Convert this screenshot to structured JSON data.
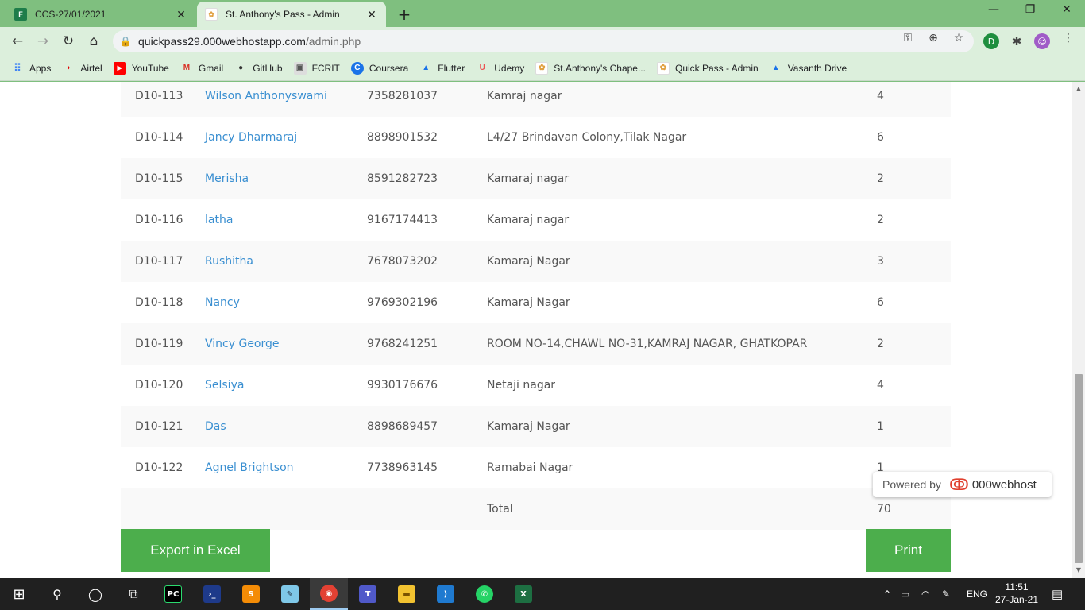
{
  "browser": {
    "tabs": [
      {
        "title": "CCS-27/01/2021",
        "icon": "forms-icon"
      },
      {
        "title": "St. Anthony's Pass - Admin",
        "icon": "site-icon"
      }
    ],
    "url_host": "quickpass29.000webhostapp.com",
    "url_path": "/admin.php",
    "bookmarks": [
      "Apps",
      "Airtel",
      "YouTube",
      "Gmail",
      "GitHub",
      "FCRIT",
      "Coursera",
      "Flutter",
      "Udemy",
      "St.Anthony's Chape...",
      "Quick Pass - Admin",
      "Vasanth Drive"
    ]
  },
  "table": {
    "rows": [
      {
        "id": "D10-113",
        "name": "Wilson Anthonyswami",
        "phone": "7358281037",
        "address": "Kamraj nagar",
        "count": "4"
      },
      {
        "id": "D10-114",
        "name": "Jancy Dharmaraj",
        "phone": "8898901532",
        "address": "L4/27 Brindavan Colony,Tilak Nagar",
        "count": "6"
      },
      {
        "id": "D10-115",
        "name": "Merisha",
        "phone": "8591282723",
        "address": "Kamaraj nagar",
        "count": "2"
      },
      {
        "id": "D10-116",
        "name": "latha",
        "phone": "9167174413",
        "address": "Kamaraj nagar",
        "count": "2"
      },
      {
        "id": "D10-117",
        "name": "Rushitha",
        "phone": "7678073202",
        "address": "Kamaraj Nagar",
        "count": "3"
      },
      {
        "id": "D10-118",
        "name": "Nancy",
        "phone": "9769302196",
        "address": "Kamaraj Nagar",
        "count": "6"
      },
      {
        "id": "D10-119",
        "name": "Vincy George",
        "phone": "9768241251",
        "address": "ROOM NO-14,CHAWL NO-31,KAMRAJ NAGAR, GHATKOPAR",
        "count": "2"
      },
      {
        "id": "D10-120",
        "name": "Selsiya",
        "phone": "9930176676",
        "address": "Netaji nagar",
        "count": "4"
      },
      {
        "id": "D10-121",
        "name": "Das",
        "phone": "8898689457",
        "address": "Kamaraj Nagar",
        "count": "1"
      },
      {
        "id": "D10-122",
        "name": "Agnel Brightson",
        "phone": "7738963145",
        "address": "Ramabai Nagar",
        "count": "1"
      }
    ],
    "total_label": "Total",
    "total_value": "70"
  },
  "actions": {
    "export_label": "Export in Excel",
    "print_label": "Print"
  },
  "powered": {
    "text": "Powered by",
    "brand": "000webhost"
  },
  "taskbar": {
    "lang": "ENG",
    "time": "11:51",
    "date": "27-Jan-21"
  }
}
